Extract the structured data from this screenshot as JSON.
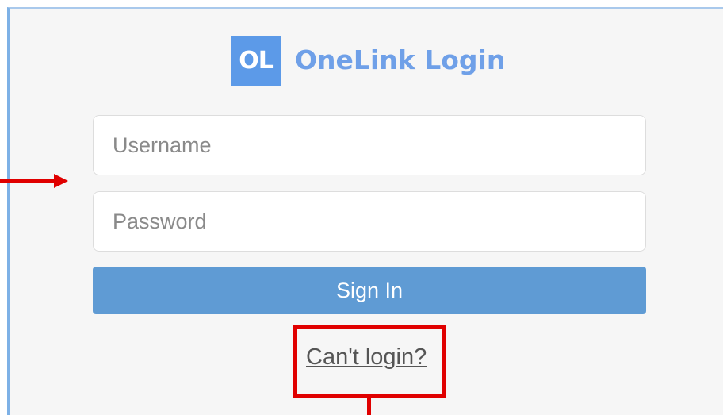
{
  "header": {
    "logo_text": "OL",
    "title": "OneLink Login"
  },
  "form": {
    "username_placeholder": "Username",
    "password_placeholder": "Password",
    "signin_label": "Sign In",
    "help_link": "Can't login?"
  },
  "colors": {
    "accent": "#5c9ae8",
    "button": "#5f9bd4",
    "annotation": "#e00000"
  }
}
